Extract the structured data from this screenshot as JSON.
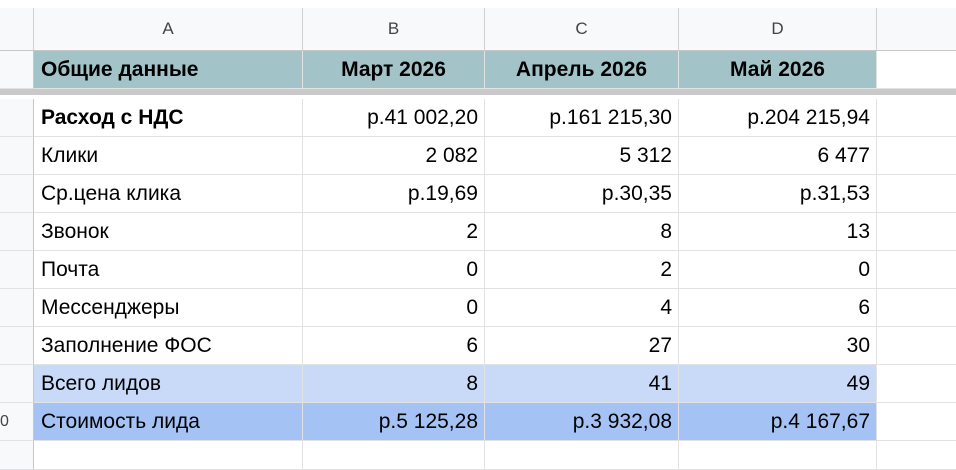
{
  "columns": [
    "A",
    "B",
    "C",
    "D"
  ],
  "header": [
    "Общие данные",
    "Март 2026",
    "Апрель 2026",
    "Май 2026"
  ],
  "rows": [
    [
      "Расход с НДС",
      "р.41 002,20",
      "р.161 215,30",
      "р.204 215,94"
    ],
    [
      "Клики",
      "2 082",
      "5 312",
      "6 477"
    ],
    [
      "Ср.цена клика",
      "р.19,69",
      "р.30,35",
      "р.31,53"
    ],
    [
      "Звонок",
      "2",
      "8",
      "13"
    ],
    [
      "Почта",
      "0",
      "2",
      "0"
    ],
    [
      "Мессенджеры",
      "0",
      "4",
      "6"
    ],
    [
      "Заполнение ФОС",
      "6",
      "27",
      "30"
    ],
    [
      "Всего лидов",
      "8",
      "41",
      "49"
    ],
    [
      "Стоимость лида",
      "р.5 125,28",
      "р.3 932,08",
      "р.4 167,67"
    ]
  ],
  "partial_row_number": "0",
  "colors": {
    "header_fill": "#a2c4c9",
    "total_fill": "#c9daf8",
    "cost_fill": "#a4c2f4"
  }
}
